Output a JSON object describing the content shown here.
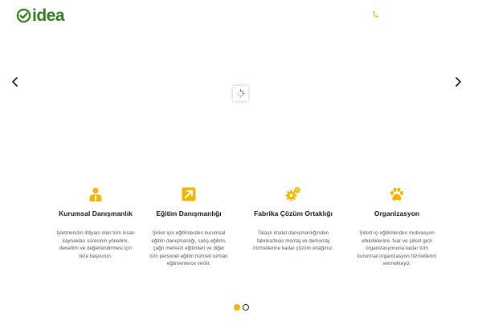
{
  "colors": {
    "accent": "#f5b400",
    "brand_green": "#2e7d1a",
    "text_dark": "#1a1a1a",
    "text_muted": "#555555"
  },
  "header": {
    "logo_text": "idea",
    "logo_icon": "check-circle-icon",
    "phone_icon": "phone-icon"
  },
  "slider": {
    "prev_icon": "chevron-left-icon",
    "next_icon": "chevron-right-icon",
    "loader_icon": "spinner-icon",
    "dots_total": 2,
    "active_dot": 1
  },
  "features": [
    {
      "icon": "person-tie-icon",
      "title": "Kurumsal Danışmanlık",
      "text": "İşletmenizin ihtiyacı olan tüm insan kaynakları sürecinin yönetimi, denetimi ve değerlendirmesi için bize başvurun."
    },
    {
      "icon": "arrow-up-right-icon",
      "title": "Eğitim Danışmanlığı",
      "text": "Şirket için eğitimlerden kurumsal eğitim danışmanlığı, satış eğitimi, çağrı merkezi eğitimleri ve diğer tüm personel eğitim hizmeti uzman eğitmenlerce verilir."
    },
    {
      "icon": "gears-icon",
      "title": "Fabrika Çözüm Ortaklığı",
      "text": "Talaşlı imalat danışmanlığından fabrika/tesis montaj ve demontaj hizmetlerine kadar çözüm ortağınız."
    },
    {
      "icon": "paw-icon",
      "title": "Organizasyon",
      "text": "Şirket içi eğitimlerden motivasyon etkinliklerine, fuar ve şirket gezi organizasyonuna kadar tüm kurumsal organizasyon hizmetlerini vermekteyiz."
    }
  ]
}
